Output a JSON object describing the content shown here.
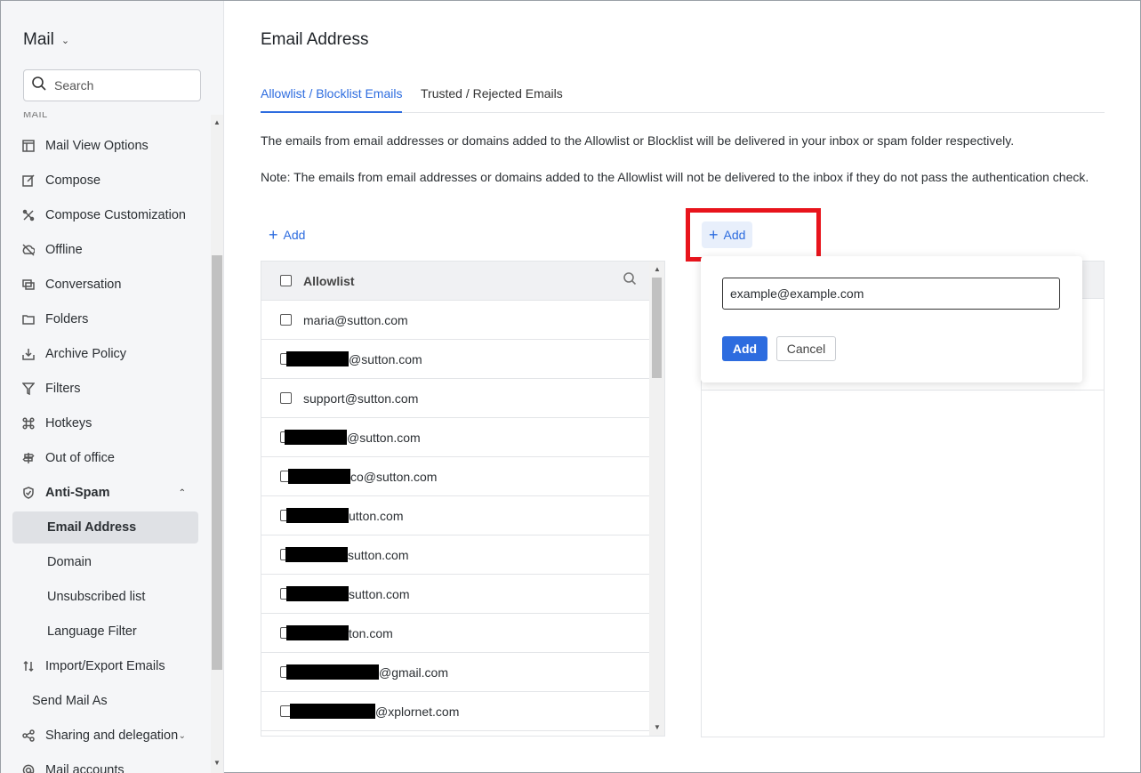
{
  "sidebar": {
    "app_title": "Mail",
    "search_placeholder": "Search",
    "section_label": "MAIL",
    "items": [
      {
        "label": "Mail View Options",
        "icon": "layout-icon"
      },
      {
        "label": "Compose",
        "icon": "compose-icon"
      },
      {
        "label": "Compose Customization",
        "icon": "customize-icon"
      },
      {
        "label": "Offline",
        "icon": "offline-icon"
      },
      {
        "label": "Conversation",
        "icon": "conversation-icon"
      },
      {
        "label": "Folders",
        "icon": "folder-icon"
      },
      {
        "label": "Archive Policy",
        "icon": "archive-icon"
      },
      {
        "label": "Filters",
        "icon": "filter-icon"
      },
      {
        "label": "Hotkeys",
        "icon": "command-icon"
      },
      {
        "label": "Out of office",
        "icon": "signpost-icon"
      },
      {
        "label": "Anti-Spam",
        "icon": "shield-icon"
      },
      {
        "label": "Email Address"
      },
      {
        "label": "Domain"
      },
      {
        "label": "Unsubscribed list"
      },
      {
        "label": "Language Filter"
      },
      {
        "label": "Import/Export Emails",
        "icon": "import-export-icon"
      },
      {
        "label": "Send Mail As"
      },
      {
        "label": "Sharing and delegation",
        "icon": "share-icon"
      },
      {
        "label": "Mail accounts",
        "icon": "at-icon"
      }
    ]
  },
  "main": {
    "title": "Email Address",
    "tabs": [
      {
        "label": "Allowlist / Blocklist Emails",
        "active": true
      },
      {
        "label": "Trusted / Rejected Emails",
        "active": false
      }
    ],
    "description": "The emails from email addresses or domains added to the Allowlist or Blocklist will be delivered in your inbox or spam folder respectively.",
    "note": "Note: The emails from email addresses or domains added to the Allowlist will not be delivered to the inbox if they do not pass the authentication check.",
    "allow_add_label": "Add",
    "block_add_label": "Add",
    "allowlist": {
      "header": "Allowlist",
      "rows": [
        {
          "text": "maria@sutton.com"
        },
        {
          "text": "@sutton.com"
        },
        {
          "text": "support@sutton.com"
        },
        {
          "text": "@sutton.com"
        },
        {
          "text": "co@sutton.com"
        },
        {
          "text": "utton.com"
        },
        {
          "text": "sutton.com"
        },
        {
          "text": "sutton.com"
        },
        {
          "text": "ton.com"
        },
        {
          "text": "@gmail.com"
        },
        {
          "text": "@xplornet.com"
        }
      ]
    },
    "popover": {
      "input_value": "example@example.com",
      "add_label": "Add",
      "cancel_label": "Cancel"
    }
  },
  "colors": {
    "accent": "#2d6cdf",
    "highlight_box": "#e8141c"
  }
}
